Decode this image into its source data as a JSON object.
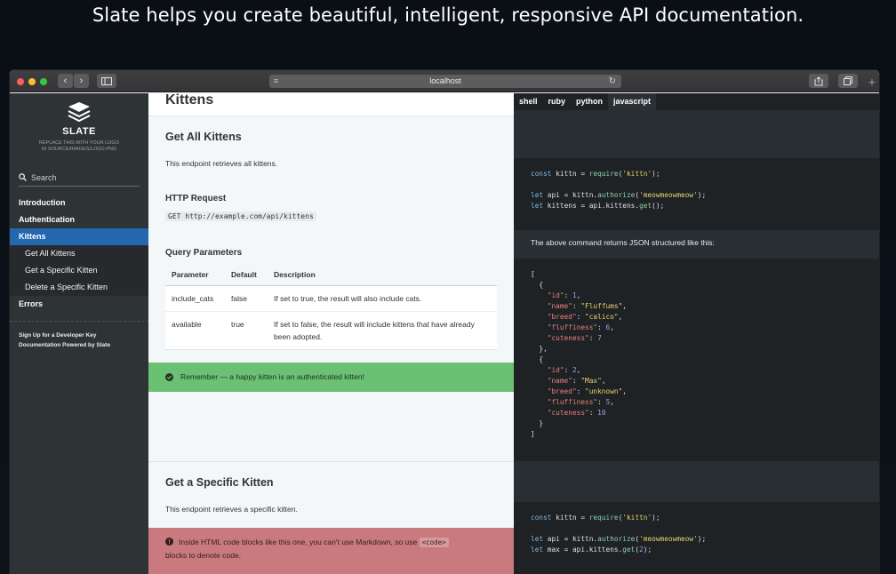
{
  "headline": "Slate helps you create beautiful, intelligent, responsive API documentation.",
  "browser": {
    "address": "localhost",
    "plus": "+"
  },
  "sidebar": {
    "logo_title": "SLATE",
    "logo_sub_line1": "REPLACE THIS WITH YOUR LOGO",
    "logo_sub_line2": "IN SOURCE/IMAGES/LOGO.PNG",
    "search_label": "Search",
    "items": [
      {
        "label": "Introduction"
      },
      {
        "label": "Authentication"
      },
      {
        "label": "Kittens",
        "active": true
      },
      {
        "label": "Errors"
      }
    ],
    "subitems": [
      {
        "label": "Get All Kittens"
      },
      {
        "label": "Get a Specific Kitten"
      },
      {
        "label": "Delete a Specific Kitten"
      }
    ],
    "footer": [
      {
        "label": "Sign Up for a Developer Key"
      },
      {
        "label": "Documentation Powered by Slate"
      }
    ]
  },
  "content": {
    "page_title": "Kittens",
    "section1": {
      "title": "Get All Kittens",
      "desc": "This endpoint retrieves all kittens.",
      "http_heading": "HTTP Request",
      "http_code": "GET http://example.com/api/kittens",
      "query_heading": "Query Parameters",
      "table": {
        "headers": [
          "Parameter",
          "Default",
          "Description"
        ],
        "rows": [
          [
            "include_cats",
            "false",
            "If set to true, the result will also include cats."
          ],
          [
            "available",
            "true",
            "If set to false, the result will include kittens that have already been adopted."
          ]
        ]
      },
      "notice": "Remember — a happy kitten is an authenticated kitten!"
    },
    "section2": {
      "title": "Get a Specific Kitten",
      "desc": "This endpoint retrieves a specific kitten.",
      "warning_pre": "Inside HTML code blocks like this one, you can't use Markdown, so use",
      "warning_code": "<code>",
      "warning_post": "blocks to denote code."
    }
  },
  "code_panel": {
    "tabs": [
      {
        "label": "shell"
      },
      {
        "label": "ruby"
      },
      {
        "label": "python"
      },
      {
        "label": "javascript",
        "active": true
      }
    ],
    "returns_text": "The above command returns JSON structured like this:"
  },
  "colors": {
    "accent": "#2467af",
    "success": "#6ac174",
    "warning": "#c97a7e",
    "sidebar_bg": "#2e3336",
    "code_bg": "#1e2224"
  }
}
